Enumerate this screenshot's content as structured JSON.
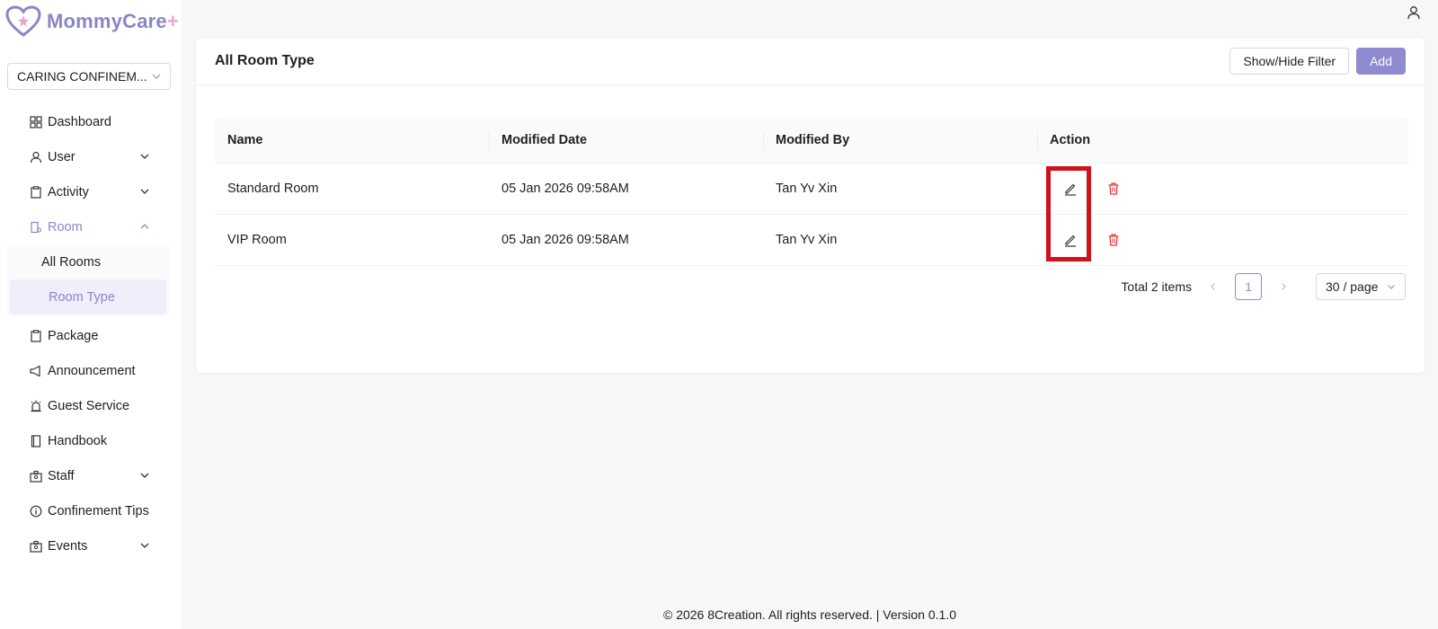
{
  "app": {
    "logo_text": "MommyCare",
    "logo_plus": "+"
  },
  "org_select": {
    "value": "CARING CONFINEM..."
  },
  "sidebar": {
    "items": [
      {
        "label": "Dashboard",
        "icon": "dashboard-icon"
      },
      {
        "label": "User",
        "icon": "user-icon"
      },
      {
        "label": "Activity",
        "icon": "clipboard-icon"
      },
      {
        "label": "Room",
        "icon": "room-icon"
      },
      {
        "label": "Package",
        "icon": "clipboard-icon"
      },
      {
        "label": "Announcement",
        "icon": "megaphone-icon"
      },
      {
        "label": "Guest Service",
        "icon": "alarm-icon"
      },
      {
        "label": "Handbook",
        "icon": "book-icon"
      },
      {
        "label": "Staff",
        "icon": "badge-icon"
      },
      {
        "label": "Confinement Tips",
        "icon": "info-icon"
      },
      {
        "label": "Events",
        "icon": "badge-icon"
      }
    ],
    "room_sub": [
      {
        "label": "All Rooms"
      },
      {
        "label": "Room Type"
      }
    ]
  },
  "page": {
    "title": "All Room Type",
    "filter_button": "Show/Hide Filter",
    "add_button": "Add"
  },
  "table": {
    "headers": {
      "name": "Name",
      "modified_date": "Modified Date",
      "modified_by": "Modified By",
      "action": "Action"
    },
    "rows": [
      {
        "name": "Standard Room",
        "modified_date": "05 Jan 2026 09:58AM",
        "modified_by": "Tan Yv Xin"
      },
      {
        "name": "VIP Room",
        "modified_date": "05 Jan 2026 09:58AM",
        "modified_by": "Tan Yv Xin"
      }
    ]
  },
  "pagination": {
    "total": "Total 2 items",
    "current_page": "1",
    "page_size": "30 / page"
  },
  "footer": {
    "text": "© 2026 8Creation. All rights reserved. | Version 0.1.0"
  },
  "colors": {
    "brand": "#8a86c4",
    "accent_pink": "#e7a8c4",
    "danger": "#d0111b",
    "delete_icon": "#e03a3a"
  }
}
